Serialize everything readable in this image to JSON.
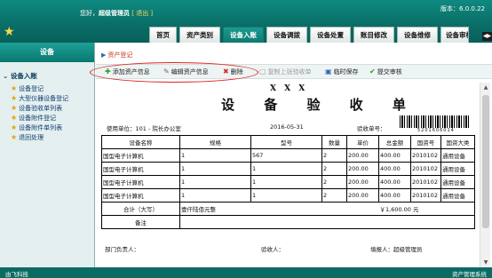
{
  "header": {
    "welcome_prefix": "您好，",
    "user": "超级管理员",
    "logout": "[ 退出 ]",
    "version": "版本：6.0.0.22",
    "tabs": [
      "首页",
      "资产类别",
      "设备入账",
      "设备调拨",
      "设备处置",
      "账目修改",
      "设备维修",
      "设备审核"
    ],
    "active_tab": "设备入账"
  },
  "sidebar": {
    "title": "设备",
    "section": "设备入账",
    "items": [
      "设备登记",
      "大型仪器设备登记",
      "设备验收单列表",
      "设备附件登记",
      "设备附件单列表",
      "退回处理"
    ]
  },
  "main": {
    "breadcrumb": "资产登记",
    "toolbar": {
      "add": "添加资产信息",
      "edit": "编辑资产信息",
      "delete": "删除",
      "copy": "复制上张验收单",
      "save": "临时保存",
      "submit": "提交审核"
    }
  },
  "document": {
    "company": "X X X",
    "title": "设 备 验 收 单",
    "unit_label": "使用单位：",
    "unit_value": "101 - 院长办公室",
    "date": "2016-05-31",
    "receipt_label": "验收单号：",
    "barcode_number": "5201606014",
    "columns": [
      "设备名称",
      "规格",
      "型号",
      "数量",
      "单价",
      "总金额",
      "国资号",
      "国资大类"
    ],
    "rows": [
      [
        "国型电子计算机",
        "1",
        "567",
        "2",
        "200.00",
        "400.00",
        "2010102",
        "通用设备"
      ],
      [
        "国型电子计算机",
        "1",
        "1",
        "2",
        "200.00",
        "400.00",
        "2010102",
        "通用设备"
      ],
      [
        "国型电子计算机",
        "1",
        "1",
        "2",
        "200.00",
        "400.00",
        "2010102",
        "通用设备"
      ],
      [
        "国型电子计算机",
        "1",
        "1",
        "2",
        "200.00",
        "400.00",
        "2010102",
        "通用设备"
      ]
    ],
    "total_label": "合计（大写）",
    "total_words": "壹仟陆佰元整",
    "total_amount": "￥1,600.00 元",
    "note_label": "备注",
    "dept_head_label": "部门负责人：",
    "inspector_label": "验收人：",
    "filler_label": "填报人：",
    "filler_value": "超级管理员"
  },
  "footer": {
    "left": "由飞科技",
    "right": "资产管理系统"
  },
  "colors": {
    "header_teal": "#0b7770",
    "highlight_red": "#e02020"
  }
}
